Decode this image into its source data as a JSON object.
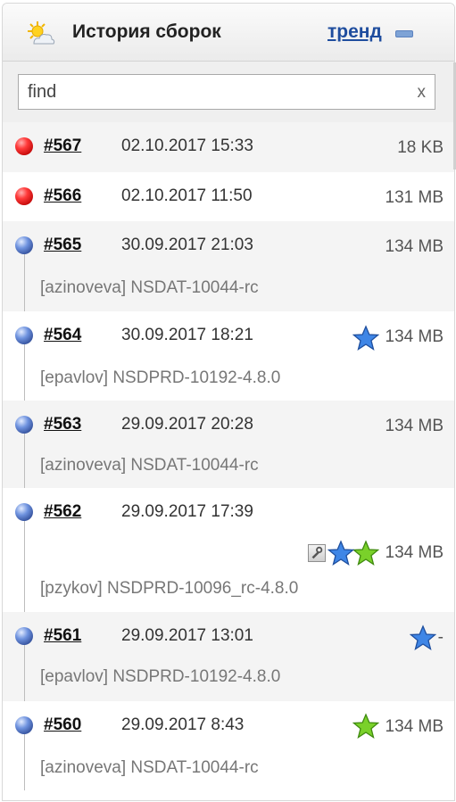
{
  "header": {
    "title": "История сборок",
    "trend_label": "тренд",
    "weather_icon": "partly-cloudy-icon",
    "collapse_icon": "minus-icon"
  },
  "search": {
    "value": "find",
    "clear_label": "x"
  },
  "colors": {
    "failed": "#e51919",
    "success": "#3b5db5",
    "link": "#1f4d9e",
    "blue_star": "#3f86e6",
    "green_star": "#7ad12a"
  },
  "builds": [
    {
      "number": "#567",
      "date": "02.10.2017 15:33",
      "size": "18 KB",
      "status": "failed"
    },
    {
      "number": "#566",
      "date": "02.10.2017 11:50",
      "size": "131 MB",
      "status": "failed"
    },
    {
      "number": "#565",
      "date": "30.09.2017 21:03",
      "size": "134 MB",
      "status": "success",
      "desc": "[azinoveva] NSDAT-10044-rc"
    },
    {
      "number": "#564",
      "date": "30.09.2017 18:21",
      "size": "134 MB",
      "status": "success",
      "desc": "[epavlov] NSDPRD-10192-4.8.0",
      "badges": [
        "blue-star-icon"
      ]
    },
    {
      "number": "#563",
      "date": "29.09.2017 20:28",
      "size": "134 MB",
      "status": "success",
      "desc": "[azinoveva] NSDAT-10044-rc"
    },
    {
      "number": "#562",
      "date": "29.09.2017 17:39",
      "size": "134 MB",
      "status": "success",
      "desc": "[pzykov] NSDPRD-10096_rc-4.8.0",
      "badges": [
        "tool-icon",
        "blue-star-icon",
        "green-star-icon"
      ]
    },
    {
      "number": "#561",
      "date": "29.09.2017 13:01",
      "size": "-",
      "status": "success",
      "desc": "[epavlov] NSDPRD-10192-4.8.0",
      "badges": [
        "blue-star-icon"
      ]
    },
    {
      "number": "#560",
      "date": "29.09.2017 8:43",
      "size": "134 MB",
      "status": "success",
      "desc": "[azinoveva] NSDAT-10044-rc",
      "badges": [
        "green-star-icon"
      ]
    }
  ]
}
